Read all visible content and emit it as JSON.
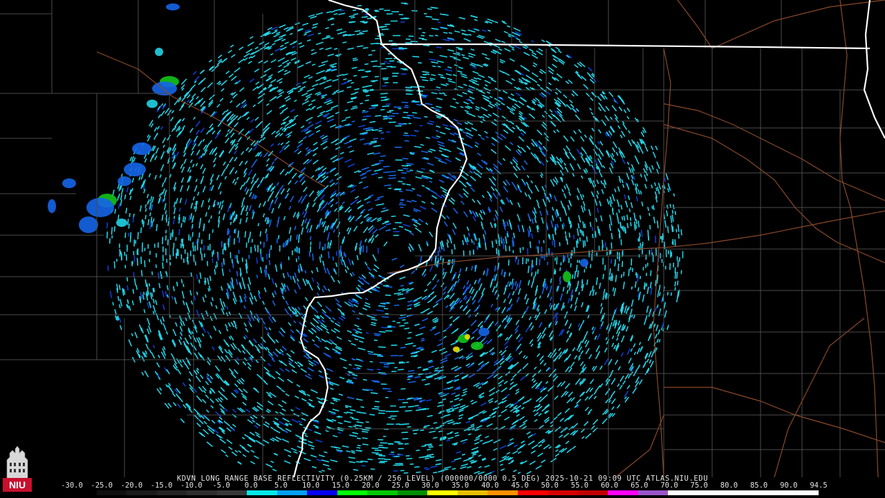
{
  "caption": "KDVN LONG RANGE BASE REFLECTIVITY (0.25KM / 256 LEVEL) (000000/0000 0.5 DEG) 2025-10-21 09:09 UTC  ATLAS.NIU.EDU",
  "logo_text": "NIU",
  "scale": {
    "min": -30.0,
    "max": 94.5,
    "ticks": [
      "-30.0",
      "-25.0",
      "-20.0",
      "-15.0",
      "-10.0",
      "-5.0",
      "0.0",
      "5.0",
      "10.0",
      "15.0",
      "20.0",
      "25.0",
      "30.0",
      "35.0",
      "40.0",
      "45.0",
      "50.0",
      "55.0",
      "60.0",
      "65.0",
      "70.0",
      "75.0",
      "80.0",
      "85.0",
      "90.0",
      "94.5"
    ],
    "colors": [
      "#000000",
      "#101010",
      "#1a1a1a",
      "#242424",
      "#2e2e2e",
      "#383838",
      "#05e8e8",
      "#01a0f6",
      "#0000f6",
      "#00ff00",
      "#00c800",
      "#009000",
      "#ffff00",
      "#e7c000",
      "#ff9000",
      "#ff0000",
      "#d60000",
      "#c00000",
      "#ff00ff",
      "#9955c9",
      "#ffffff",
      "#ffffff",
      "#ffffff",
      "#ffffff",
      "#ffffff"
    ]
  },
  "colors": {
    "background": "#000000",
    "county_lines": "#555555",
    "state_lines": "#ffffff",
    "highways": "#8b4a2b",
    "light_return": "#22d3e6",
    "medium_return": "#1565e8",
    "moderate_return": "#13c41a",
    "strong_return": "#f0e000"
  },
  "icons": [
    "niu-tower-logo"
  ]
}
